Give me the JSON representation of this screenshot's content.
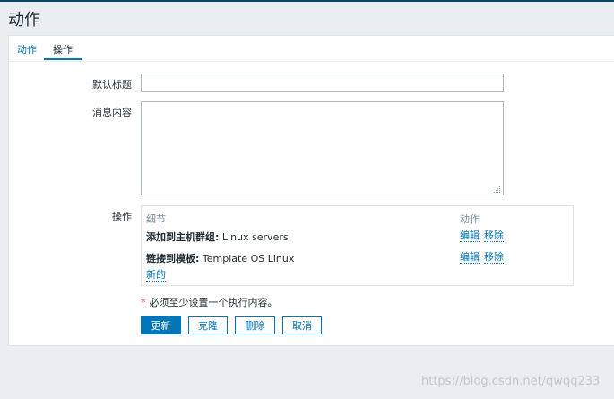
{
  "page": {
    "title": "动作"
  },
  "tabs": [
    {
      "label": "动作",
      "active": false
    },
    {
      "label": "操作",
      "active": true
    }
  ],
  "form": {
    "subject_label": "默认标题",
    "subject_value": "",
    "message_label": "消息内容",
    "message_value": "",
    "operations_label": "操作"
  },
  "operations": {
    "header_details": "细节",
    "header_action": "动作",
    "rows": [
      {
        "type": "添加到主机群组:",
        "value": " Linux servers",
        "edit": "编辑",
        "remove": "移除"
      },
      {
        "type": "链接到模板:",
        "value": " Template OS Linux",
        "edit": "编辑",
        "remove": "移除"
      }
    ],
    "new_label": "新的"
  },
  "note": {
    "star": "*",
    "text": "必须至少设置一个执行内容。"
  },
  "buttons": {
    "update": "更新",
    "clone": "克隆",
    "delete": "删除",
    "cancel": "取消"
  },
  "watermark": "https://blog.csdn.net/qwqq233",
  "colors": {
    "accent": "#0275b8",
    "background": "#ebeef0",
    "required": "#e33734"
  }
}
